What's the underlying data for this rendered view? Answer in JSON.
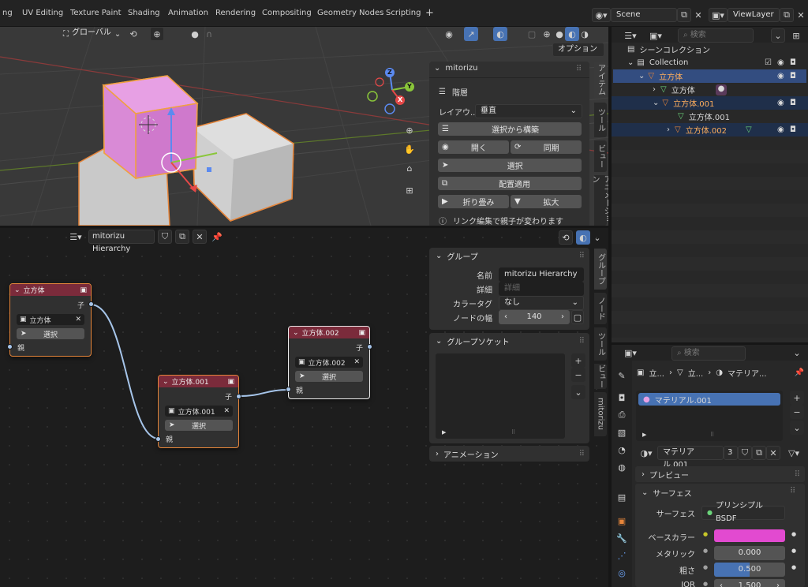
{
  "topbar": {
    "tabs": [
      "ng",
      "UV Editing",
      "Texture Paint",
      "Shading",
      "Animation",
      "Rendering",
      "Compositing",
      "Geometry Nodes",
      "Scripting"
    ],
    "add_tab": "+",
    "scene": "Scene",
    "view_layer": "ViewLayer"
  },
  "viewport": {
    "orientation": "グローバル",
    "options_label": "オプション",
    "npanel": {
      "title": "mitorizu",
      "section": "階層",
      "layout_label": "レイアウ...",
      "layout_value": "垂直",
      "build_btn": "選択から構築",
      "open_btn": "開く",
      "sync_btn": "同期",
      "select_btn": "選択",
      "apply_btn": "配置適用",
      "collapse_btn": "折り畳み",
      "expand_btn": "拡大",
      "info": "リンク編集で親子が変わります"
    },
    "side_tabs": [
      "アイテム",
      "ツール",
      "ビュー",
      "アニメーション"
    ],
    "gizmo": {
      "x": "X",
      "y": "Y",
      "z": "Z"
    }
  },
  "outliner": {
    "search_placeholder": "検索",
    "rows": [
      {
        "label": "シーンコレクション"
      },
      {
        "label": "Collection"
      },
      {
        "label": "立方体"
      },
      {
        "label": "立方体"
      },
      {
        "label": "立方体.001"
      },
      {
        "label": "立方体.001"
      },
      {
        "label": "立方体.002"
      }
    ]
  },
  "node_editor": {
    "tree_name": "mitorizu Hierarchy",
    "side_tabs": [
      "グループ",
      "ノード",
      "ツール",
      "ビュー",
      "mitorizu"
    ],
    "nodes": [
      {
        "title": "立方体",
        "out": "子",
        "object": "立方体",
        "select": "選択",
        "in": "親"
      },
      {
        "title": "立方体.001",
        "out": "子",
        "object": "立方体.001",
        "select": "選択",
        "in": "親"
      },
      {
        "title": "立方体.002",
        "out": "子",
        "object": "立方体.002",
        "select": "選択",
        "in": "親"
      }
    ],
    "group_panel": {
      "title": "グループ",
      "name_label": "名前",
      "name_value": "mitorizu Hierarchy",
      "desc_label": "詳細",
      "desc_placeholder": "詳細",
      "color_label": "カラータグ",
      "color_value": "なし",
      "width_label": "ノードの幅",
      "width_value": "140"
    },
    "socket_panel": {
      "title": "グループソケット"
    },
    "anim_panel": {
      "title": "アニメーション"
    }
  },
  "properties": {
    "search_placeholder": "検索",
    "breadcrumb": [
      "立...",
      "立...",
      "マテリア..."
    ],
    "slot": "マテリアル.001",
    "material_name": "マテリアル.001",
    "users": "3",
    "preview": "プレビュー",
    "surface_section": "サーフェス",
    "surface_label": "サーフェス",
    "surface_value": "プリンシプルBSDF",
    "base_color_label": "ベースカラー",
    "metallic_label": "メタリック",
    "metallic_value": "0.000",
    "roughness_label": "粗さ",
    "roughness_value": "0.500",
    "roughness_fraction": 0.5,
    "ior_label": "IOR",
    "ior_value": "1.500"
  },
  "colors": {
    "accent": "#4772b3",
    "selected_orange": "#e6853a",
    "node_header": "#7b2b3b",
    "base_color": "#e24ad0",
    "link": "#a6c5ea"
  }
}
